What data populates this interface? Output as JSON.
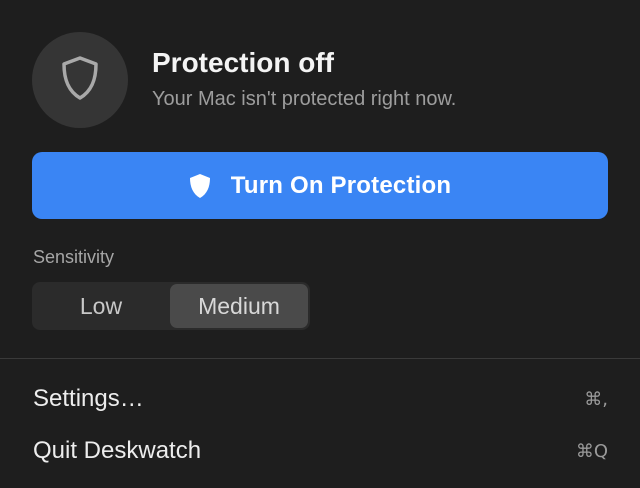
{
  "status": {
    "title": "Protection off",
    "subtitle": "Your Mac isn't protected right now."
  },
  "primary_button": {
    "label": "Turn On Protection",
    "icon": "shield-icon"
  },
  "sensitivity": {
    "label": "Sensitivity",
    "options": [
      "Low",
      "Medium"
    ],
    "selected": "Medium"
  },
  "menu": {
    "items": [
      {
        "label": "Settings…",
        "shortcut": "⌘,"
      },
      {
        "label": "Quit Deskwatch",
        "shortcut": "⌘Q"
      }
    ]
  },
  "colors": {
    "accent": "#3a85f4",
    "background": "#1e1e1e"
  }
}
